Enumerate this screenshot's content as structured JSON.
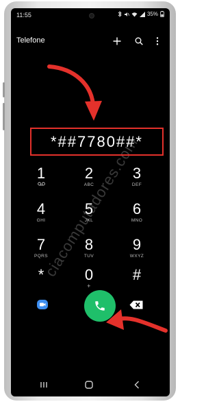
{
  "status_bar": {
    "time": "11:55",
    "battery": "35%"
  },
  "header": {
    "title": "Telefone",
    "icons": [
      "plus-icon",
      "search-icon",
      "more-vert-icon"
    ]
  },
  "watermark": "ciacomputadores.com",
  "dialer": {
    "number": "*##7780##*",
    "keys": [
      {
        "digit": "1",
        "letters": "QO"
      },
      {
        "digit": "2",
        "letters": "ABC"
      },
      {
        "digit": "3",
        "letters": "DEF"
      },
      {
        "digit": "4",
        "letters": "GHI"
      },
      {
        "digit": "5",
        "letters": "JKL"
      },
      {
        "digit": "6",
        "letters": "MNO"
      },
      {
        "digit": "7",
        "letters": "PQRS"
      },
      {
        "digit": "8",
        "letters": "TUV"
      },
      {
        "digit": "9",
        "letters": "WXYZ"
      },
      {
        "digit": "*",
        "letters": ""
      },
      {
        "digit": "0",
        "letters": "+"
      },
      {
        "digit": "#",
        "letters": ""
      }
    ]
  },
  "actions": [
    "video-call-icon",
    "phone-icon",
    "backspace-icon"
  ],
  "nav": [
    "recents-icon",
    "home-icon",
    "back-icon"
  ],
  "colors": {
    "highlight": "#e4312b",
    "call_button": "#1fbf6a",
    "video_icon": "#3d8ef0"
  }
}
